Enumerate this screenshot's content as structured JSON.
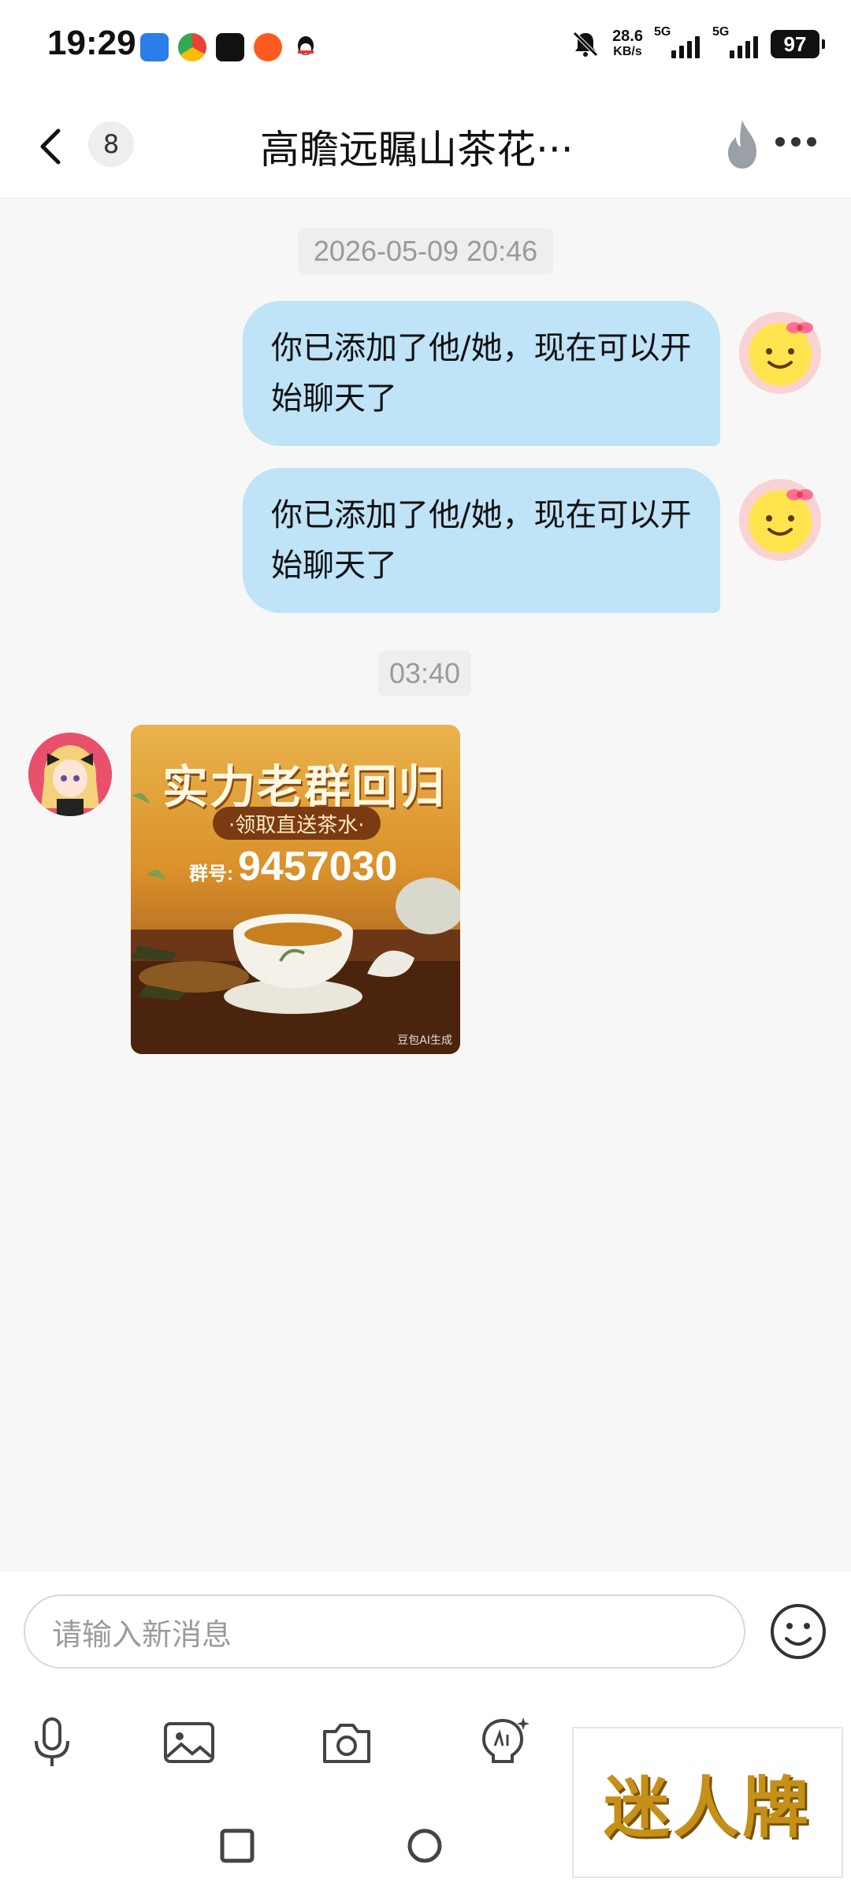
{
  "status_bar": {
    "time": "19:29",
    "net_speed_value": "28.6",
    "net_speed_unit": "KB/s",
    "signal_1_label": "5G",
    "signal_2_label": "5G",
    "battery_level": "97"
  },
  "header": {
    "unread_count": "8",
    "title": "高瞻远瞩山茶花···"
  },
  "messages": [
    {
      "type": "timestamp",
      "text": "2026-05-09 20:46"
    },
    {
      "type": "outgoing",
      "text": "你已添加了他/她，现在可以开始聊天了"
    },
    {
      "type": "outgoing",
      "text": "你已添加了他/她，现在可以开始聊天了"
    },
    {
      "type": "timestamp",
      "text": "03:40"
    },
    {
      "type": "incoming-image",
      "image": {
        "headline": "实力老群回归",
        "pill": "·领取直送茶水·",
        "group_label": "群号:",
        "group_number": "9457030",
        "watermark": "豆包AI生成"
      }
    }
  ],
  "composer": {
    "placeholder": "请输入新消息"
  },
  "toolbar": {
    "icons": [
      "microphone-icon",
      "image-icon",
      "camera-icon",
      "ai-assistant-icon"
    ]
  },
  "overlay_watermark": "迷人牌",
  "colors": {
    "outgoing_bubble": "#bfe3f7",
    "background": "#f7f7f7",
    "timestamp_bg": "#eeeeee"
  }
}
